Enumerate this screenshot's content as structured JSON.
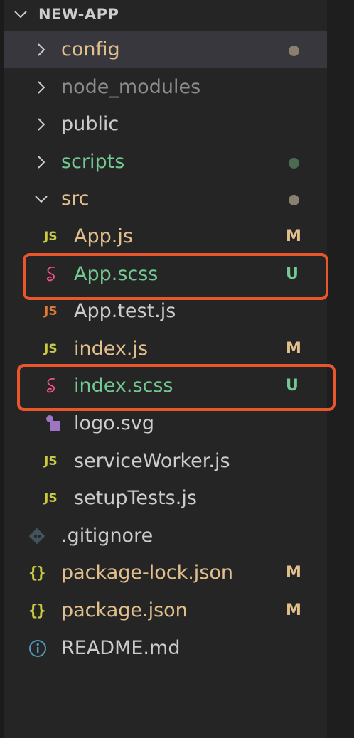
{
  "explorer": {
    "title": "NEW-APP",
    "items": [
      {
        "label": "config",
        "type": "folder",
        "expanded": false,
        "color": "#e2c08d",
        "status_dot": "#8a8070",
        "selected": true
      },
      {
        "label": "node_modules",
        "type": "folder",
        "expanded": false,
        "color": "#8c8c8c"
      },
      {
        "label": "public",
        "type": "folder",
        "expanded": false,
        "color": "#cccccc"
      },
      {
        "label": "scripts",
        "type": "folder",
        "expanded": false,
        "color": "#73c991",
        "status_dot": "#4a6b52"
      },
      {
        "label": "src",
        "type": "folder",
        "expanded": true,
        "color": "#e2c08d",
        "status_dot": "#8a8070"
      },
      {
        "label": "App.js",
        "type": "file",
        "icon": "javascript-icon",
        "icon_text": "JS",
        "icon_color": "#cbcb41",
        "color": "#e2c08d",
        "badge": "M",
        "badge_color": "#e2c08d"
      },
      {
        "label": "App.scss",
        "type": "file",
        "icon": "sass-icon",
        "icon_color": "#f55385",
        "color": "#73c991",
        "badge": "U",
        "badge_color": "#73c991",
        "highlighted": true
      },
      {
        "label": "App.test.js",
        "type": "file",
        "icon": "javascript-test-icon",
        "icon_text": "JS",
        "icon_color": "#e37933",
        "color": "#cccccc"
      },
      {
        "label": "index.js",
        "type": "file",
        "icon": "javascript-icon",
        "icon_text": "JS",
        "icon_color": "#cbcb41",
        "color": "#e2c08d",
        "badge": "M",
        "badge_color": "#e2c08d"
      },
      {
        "label": "index.scss",
        "type": "file",
        "icon": "sass-icon",
        "icon_color": "#f55385",
        "color": "#73c991",
        "badge": "U",
        "badge_color": "#73c991",
        "highlighted": true
      },
      {
        "label": "logo.svg",
        "type": "file",
        "icon": "svg-icon",
        "icon_color": "#a074c4",
        "color": "#cccccc"
      },
      {
        "label": "serviceWorker.js",
        "type": "file",
        "icon": "javascript-icon",
        "icon_text": "JS",
        "icon_color": "#cbcb41",
        "color": "#cccccc"
      },
      {
        "label": "setupTests.js",
        "type": "file",
        "icon": "javascript-icon",
        "icon_text": "JS",
        "icon_color": "#cbcb41",
        "color": "#cccccc"
      },
      {
        "label": ".gitignore",
        "type": "file",
        "icon": "git-icon",
        "icon_color": "#41535b",
        "color": "#cccccc",
        "root": true
      },
      {
        "label": "package-lock.json",
        "type": "file",
        "icon": "json-icon",
        "icon_text": "{}",
        "icon_color": "#cbcb41",
        "color": "#e2c08d",
        "badge": "M",
        "badge_color": "#e2c08d",
        "root": true
      },
      {
        "label": "package.json",
        "type": "file",
        "icon": "json-icon",
        "icon_text": "{}",
        "icon_color": "#cbcb41",
        "color": "#e2c08d",
        "badge": "M",
        "badge_color": "#e2c08d",
        "root": true
      },
      {
        "label": "README.md",
        "type": "file",
        "icon": "info-icon",
        "icon_color": "#519aba",
        "color": "#cccccc",
        "root": true
      }
    ]
  },
  "colors": {
    "highlight_box": "#e9562c",
    "background": "#252526",
    "selection": "#37373d"
  }
}
